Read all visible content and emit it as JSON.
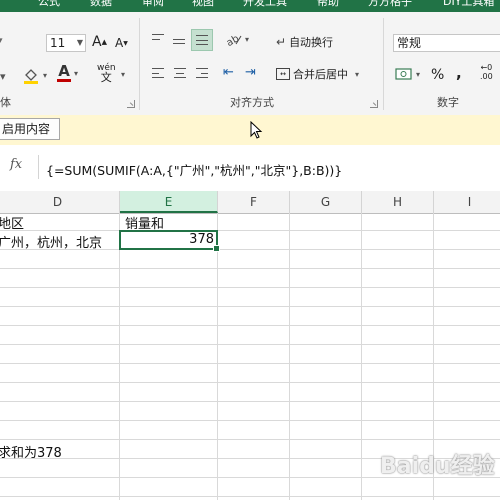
{
  "ribbon_tabs": [
    "公式",
    "数据",
    "审阅",
    "视图",
    "开发工具",
    "帮助",
    "方方格子",
    "DIY工具箱"
  ],
  "font": {
    "size_value": "11",
    "grow_label": "A",
    "shrink_label": "A",
    "wen_label": "wén",
    "font_color_label": "A",
    "group_label": "体"
  },
  "alignment": {
    "wrap_text_label": "自动换行",
    "merge_center_label": "合并后居中",
    "group_label": "对齐方式"
  },
  "number": {
    "format_value": "常规",
    "percent_label": "%",
    "comma_label": ",",
    "group_label": "数字"
  },
  "message_bar": {
    "enable_content_label": "启用内容"
  },
  "formula_bar": {
    "fx_label": "fx",
    "formula": "{=SUM(SUMIF(A:A,{\"广州\",\"杭州\",\"北京\"},B:B))}"
  },
  "columns": [
    "D",
    "E",
    "F",
    "G",
    "H",
    "I"
  ],
  "cells": {
    "d1": "地区",
    "d2": "广州，杭州，北京",
    "e1": "销量和",
    "e2": "378",
    "d12": "求和为378"
  },
  "watermark": "Baidu经验",
  "colors": {
    "excel_green": "#217346",
    "message_bar": "#fff7d1",
    "font_color_red": "#c00000"
  }
}
